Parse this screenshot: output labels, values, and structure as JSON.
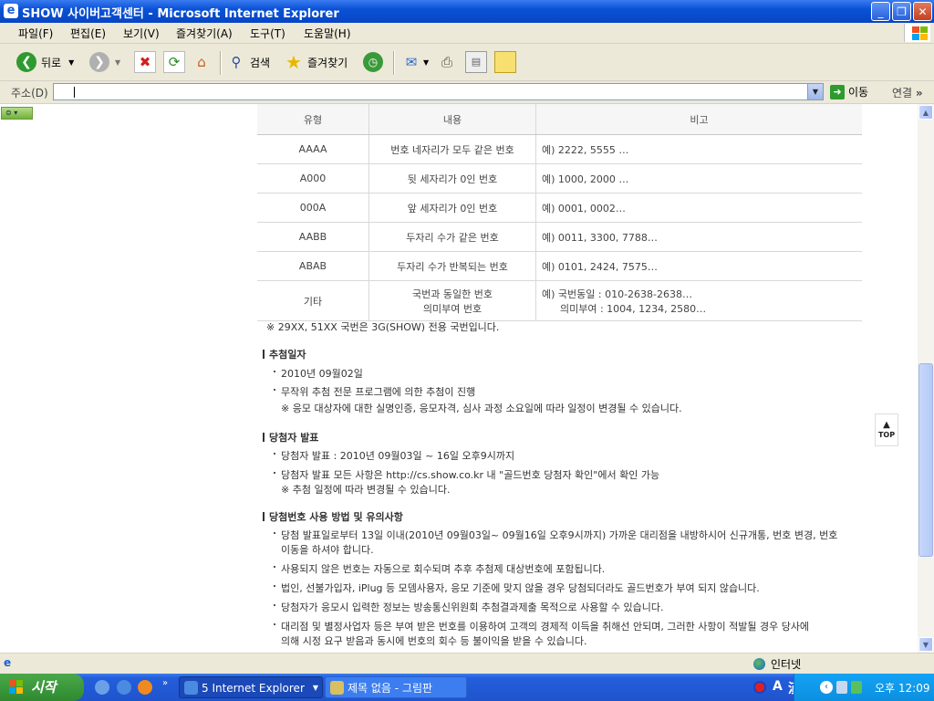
{
  "window": {
    "title": "SHOW 사이버고객센터 - Microsoft Internet Explorer",
    "title_icon": "ie-page-icon"
  },
  "menu": [
    "파일(F)",
    "편집(E)",
    "보기(V)",
    "즐겨찾기(A)",
    "도구(T)",
    "도움말(H)"
  ],
  "toolbar": {
    "back_label": "뒤로",
    "search_label": "검색",
    "favorites_label": "즐겨찾기"
  },
  "address": {
    "label": "주소(D)",
    "value": "",
    "go_label": "이동",
    "links_label": "연결"
  },
  "table": {
    "headers": [
      "유형",
      "내용",
      "비고"
    ],
    "rows": [
      {
        "type": "AAAA",
        "content": "번호 네자리가 모두 같은 번호",
        "note": "예) 2222, 5555 …"
      },
      {
        "type": "A000",
        "content": "뒷 세자리가 0인 번호",
        "note": "예) 1000, 2000 …"
      },
      {
        "type": "000A",
        "content": "앞 세자리가 0인 번호",
        "note": "예) 0001, 0002…"
      },
      {
        "type": "AABB",
        "content": "두자리 수가 같은 번호",
        "note": "예) 0011, 3300, 7788…"
      },
      {
        "type": "ABAB",
        "content": "두자리 수가 반복되는 번호",
        "note": "예) 0101, 2424, 7575…"
      },
      {
        "type": "기타",
        "content1": "국번과 동일한 번호",
        "content2": "의미부여 번호",
        "note1": "예) 국번동일 : 010-2638-2638…",
        "note2": "의미부여 : 1004, 1234, 2580…"
      }
    ]
  },
  "notice": "※ 29XX, 51XX 국번은 3G(SHOW) 전용 국번입니다.",
  "sections": {
    "draw_date": {
      "title": "추첨일자",
      "items": [
        "2010년 09월02일",
        "무작위 추첨 전문 프로그램에 의한 추첨이 진행"
      ],
      "note": "※ 응모 대상자에 대한 실명인증, 응모자격, 심사 과정 소요일에 따라 일정이 변경될 수 있습니다."
    },
    "announce": {
      "title": "당첨자 발표",
      "items": [
        "당첨자 발표 : 2010년 09월03일 ~ 16일 오후9시까지",
        "당첨자 발표 모든 사항은 http://cs.show.co.kr 내 \"골드번호 당첨자 확인\"에서 확인 가능"
      ],
      "note": "※ 추첨 일정에 따라 변경될 수 있습니다."
    },
    "usage": {
      "title": "당첨번호 사용 방법 및 유의사항",
      "item1a": "당첨 발표일로부터 13일 이내(2010년 09월03일~ 09월16일 오후9시까지) 가까운 대리점을 내방하시어 신규개통, 번호 변경, 번호",
      "item1b": "이동을 하셔야 합니다.",
      "item2": "사용되지 않은 번호는 자동으로 회수되며 추후 추첨제 대상번호에 포함됩니다.",
      "item3": "법인, 선불가입자, iPlug 등 모뎀사용자, 응모 기준에 맞지 않을 경우 당첨되더라도 골드번호가 부여 되지 않습니다.",
      "item4": "당첨자가 응모시 입력한 정보는 방송통신위원회 추첨결과제출 목적으로 사용할 수 있습니다.",
      "item5a": "대리점 및 별정사업자 등은 부여 받은 번호를 이용하여 고객의 경제적 이득을 취해선 안되며, 그러한 사항이 적발될 경우 당사에",
      "item5b": "의해 시정 요구 받음과 동시에 번호의 회수 등 불이익을 받을 수 있습니다."
    }
  },
  "top_button": "TOP",
  "status": {
    "zone": "인터넷"
  },
  "taskbar": {
    "start": "시작",
    "tasks": [
      "5 Internet Explorer",
      "제목 없음 - 그림판"
    ],
    "clock": "오후 12:09",
    "ime_a": "A",
    "ime_han": "漢"
  }
}
